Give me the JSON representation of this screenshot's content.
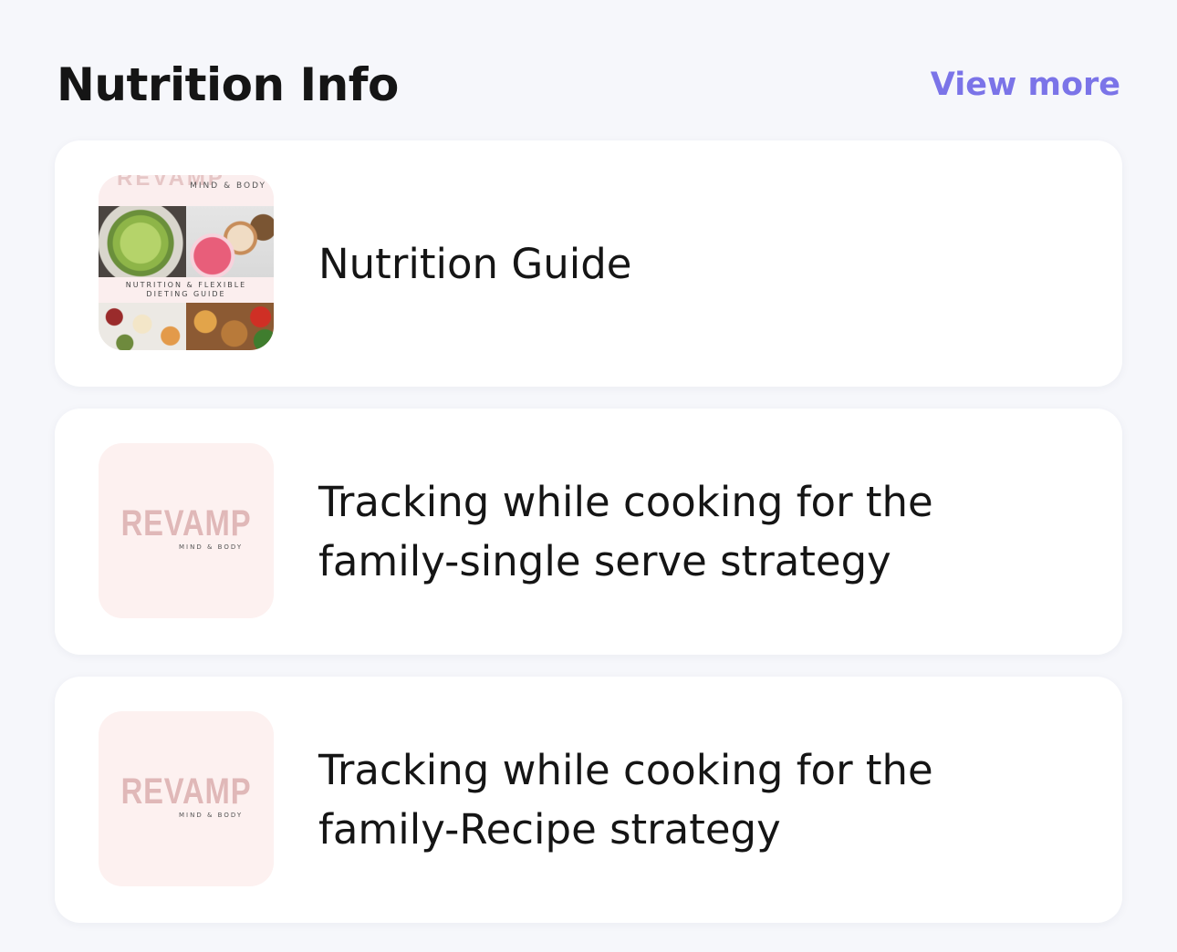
{
  "header": {
    "title": "Nutrition Info",
    "view_more": "View more"
  },
  "items": [
    {
      "label": "Nutrition Guide",
      "thumb": {
        "logo": "REVAMP",
        "tag": "MIND & BODY",
        "caption_line1": "NUTRITION & FLEXIBLE",
        "caption_line2": "DIETING GUIDE"
      }
    },
    {
      "label": "Tracking while cooking for the family-single serve strategy",
      "thumb": {
        "logo": "REVAMP",
        "tag": "MIND & BODY"
      }
    },
    {
      "label": "Tracking while cooking for the family-Recipe strategy",
      "thumb": {
        "logo": "REVAMP",
        "tag": "MIND & BODY"
      }
    }
  ],
  "colors": {
    "accent": "#7b74e8",
    "page_bg": "#f6f7fb",
    "card_bg": "#ffffff",
    "thumb_bg": "#fdf1f0",
    "logo_color": "#e0b8b8"
  }
}
